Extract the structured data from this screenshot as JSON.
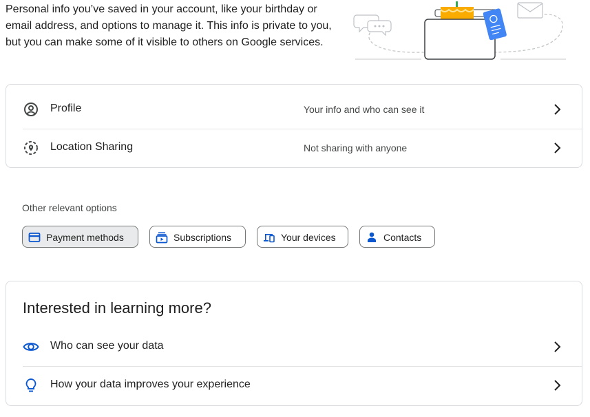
{
  "intro": {
    "text": "Personal info you’ve saved in your account, like your birthday or email address, and options to manage it. This info is private to you, but you can make some of it visible to others on Google services."
  },
  "rows": [
    {
      "label": "Profile",
      "description": "Your info and who can see it",
      "icon": "account-circle-icon"
    },
    {
      "label": "Location Sharing",
      "description": "Not sharing with anyone",
      "icon": "location-sharing-icon"
    }
  ],
  "other_options": {
    "heading": "Other relevant options",
    "chips": [
      {
        "label": "Payment methods",
        "icon": "credit-card-icon",
        "selected": true
      },
      {
        "label": "Subscriptions",
        "icon": "subscriptions-icon",
        "selected": false
      },
      {
        "label": "Your devices",
        "icon": "devices-icon",
        "selected": false
      },
      {
        "label": "Contacts",
        "icon": "person-icon",
        "selected": false
      }
    ]
  },
  "learn_more": {
    "title": "Interested in learning more?",
    "items": [
      {
        "label": "Who can see your data",
        "icon": "eye-icon"
      },
      {
        "label": "How your data improves your experience",
        "icon": "lightbulb-icon"
      }
    ]
  },
  "colors": {
    "accent_blue": "#0b57d0",
    "border": "#dadce0",
    "text_primary": "#1f1f1f",
    "text_secondary": "#444746"
  }
}
